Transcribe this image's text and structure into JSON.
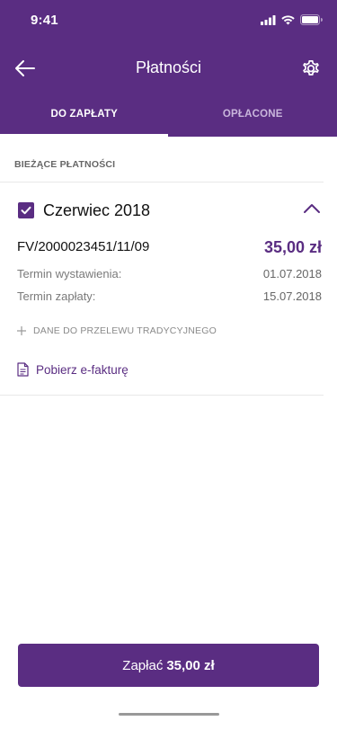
{
  "status_bar": {
    "time": "9:41"
  },
  "nav": {
    "title": "Płatności"
  },
  "tabs": [
    {
      "label": "DO ZAPŁATY"
    },
    {
      "label": "OPŁACONE"
    }
  ],
  "section": {
    "label": "BIEŻĄCE PŁATNOŚCI"
  },
  "payment": {
    "month": "Czerwiec 2018",
    "checked": true,
    "invoice_number": "FV/2000023451/11/09",
    "amount": "35,00 zł",
    "issue_label": "Termin wystawienia:",
    "issue_date": "01.07.2018",
    "due_label": "Termin zapłaty:",
    "due_date": "15.07.2018",
    "transfer_details_label": "DANE DO PRZELEWU TRADYCYJNEGO",
    "download_label": "Pobierz e-fakturę"
  },
  "pay_button": {
    "label": "Zapłać",
    "amount": "35,00 zł"
  },
  "colors": {
    "brand": "#5a2d82",
    "background": "#ffffff",
    "muted_text": "#7a7a7a",
    "divider": "#e8e8e8"
  },
  "icons": [
    "signal-icon",
    "wifi-icon",
    "battery-icon",
    "back-arrow-icon",
    "gear-icon",
    "checkbox-checked-icon",
    "chevron-up-icon",
    "plus-icon",
    "document-icon"
  ]
}
